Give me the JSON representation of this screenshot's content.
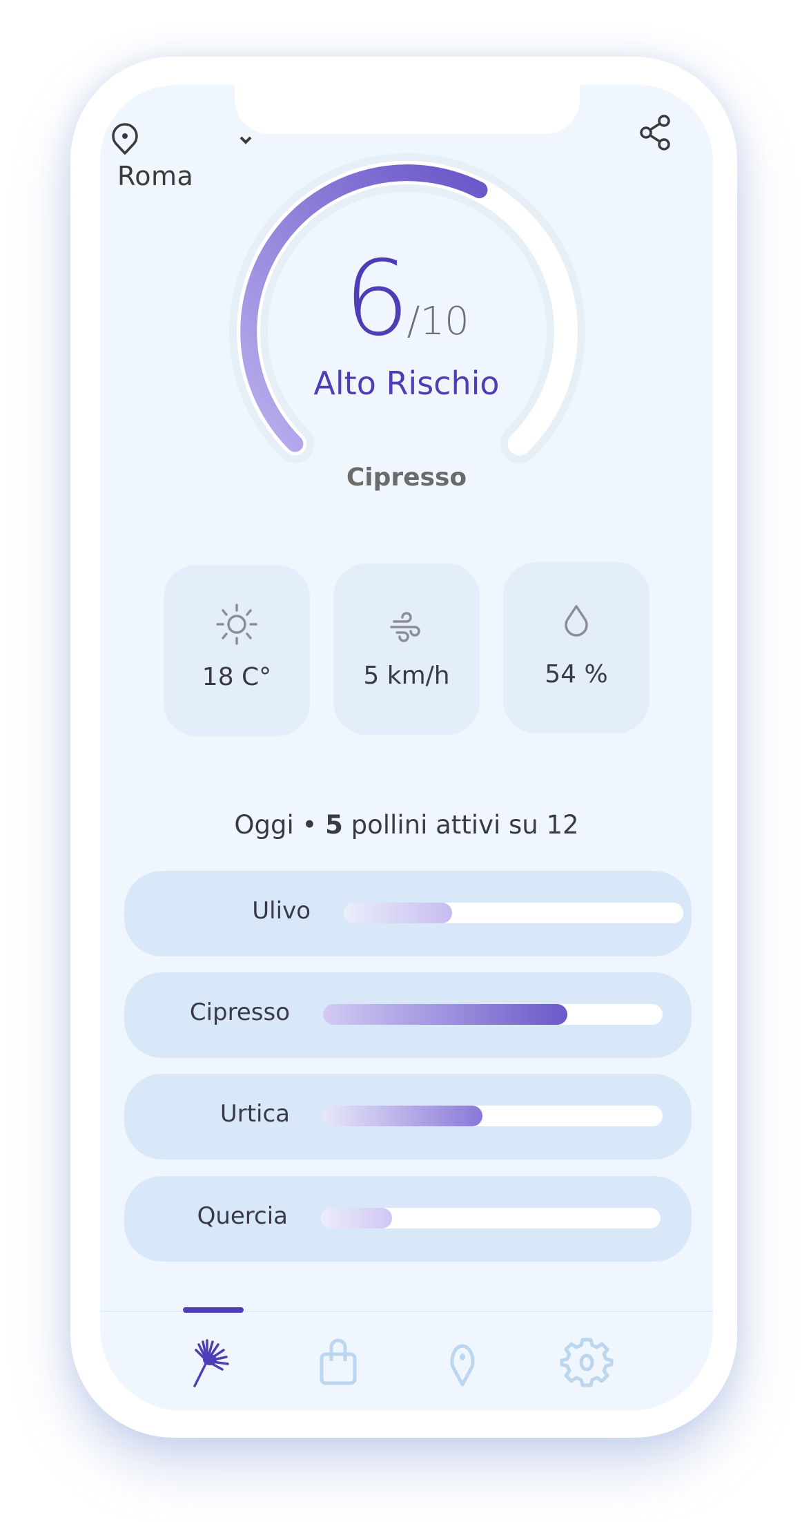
{
  "header": {
    "location_icon": "map-pin-icon",
    "city": "Roma",
    "dropdown_icon": "chevron-down-icon",
    "share_icon": "share-icon"
  },
  "risk": {
    "score": "6",
    "max_label": "/10",
    "score_value": 6,
    "score_max": 10,
    "level_label": "Alto Rischio",
    "main_allergen": "Cipresso",
    "accent_color": "#4f3db5"
  },
  "weather": [
    {
      "icon": "sun-icon",
      "value": "18 C°"
    },
    {
      "icon": "wind-icon",
      "value": "5 km/h"
    },
    {
      "icon": "droplet-icon",
      "value": "54 %"
    }
  ],
  "summary": {
    "prefix": "Oggi • ",
    "active_count": "5",
    "suffix": " pollini attivi su 12"
  },
  "pollens": [
    {
      "name": "Ulivo",
      "level_percent": 32
    },
    {
      "name": "Cipresso",
      "level_percent": 72
    },
    {
      "name": "Urtica",
      "level_percent": 47
    },
    {
      "name": "Quercia",
      "level_percent": 21
    }
  ],
  "nav": {
    "items": [
      {
        "icon": "dandelion-icon",
        "active": true
      },
      {
        "icon": "shopping-bag-icon",
        "active": false
      },
      {
        "icon": "map-pin-icon",
        "active": false
      },
      {
        "icon": "settings-gear-icon",
        "active": false
      }
    ],
    "active_color": "#4f3db5",
    "inactive_color": "#bcd6ef"
  }
}
